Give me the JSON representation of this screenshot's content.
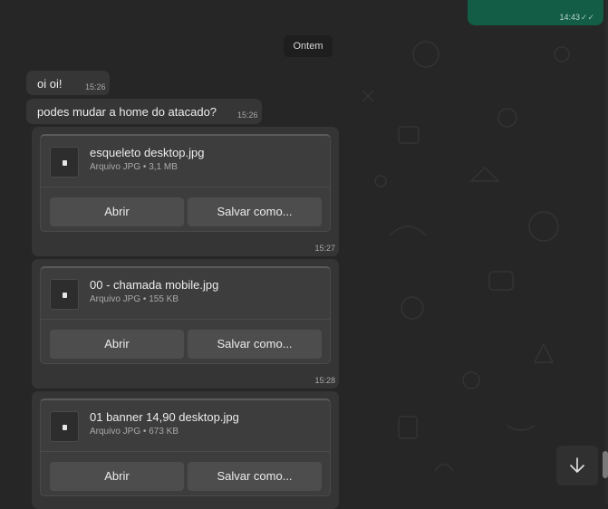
{
  "outgoing": {
    "time": "14:43",
    "status_icon": "double-check-icon"
  },
  "date_divider": "Ontem",
  "messages": [
    {
      "text": "oi oi!",
      "time": "15:26"
    },
    {
      "text": "podes mudar a home do atacado?",
      "time": "15:26"
    }
  ],
  "attachments": [
    {
      "name": "esqueleto desktop.jpg",
      "meta": "Arquivo JPG • 3,1 MB",
      "open": "Abrir",
      "save": "Salvar como...",
      "time": "15:27"
    },
    {
      "name": "00 - chamada mobile.jpg",
      "meta": "Arquivo JPG • 155 KB",
      "open": "Abrir",
      "save": "Salvar como...",
      "time": "15:28"
    },
    {
      "name": "01 banner 14,90 desktop.jpg",
      "meta": "Arquivo JPG • 673 KB",
      "open": "Abrir",
      "save": "Salvar como...",
      "time": ""
    }
  ],
  "icons": {
    "file": "document-icon",
    "scroll_down": "arrow-down-icon"
  },
  "colors": {
    "background": "#262626",
    "incoming_bubble": "#363636",
    "outgoing_bubble": "#135c45"
  }
}
